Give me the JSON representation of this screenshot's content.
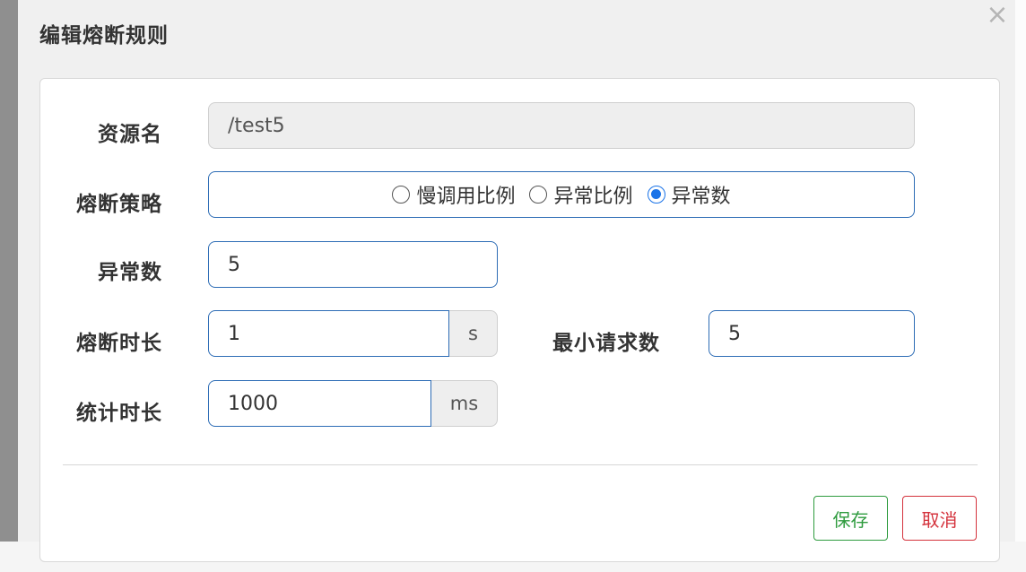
{
  "modal": {
    "title": "编辑熔断规则",
    "close_glyph": "×"
  },
  "form": {
    "resource": {
      "label": "资源名",
      "value": "/test5"
    },
    "strategy": {
      "label": "熔断策略",
      "options": [
        "慢调用比例",
        "异常比例",
        "异常数"
      ],
      "selected": "异常数"
    },
    "exception_count": {
      "label": "异常数",
      "value": "5"
    },
    "break_duration": {
      "label": "熔断时长",
      "value": "1",
      "unit": "s"
    },
    "min_request": {
      "label": "最小请求数",
      "value": "5"
    },
    "stat_duration": {
      "label": "统计时长",
      "value": "1000",
      "unit": "ms"
    }
  },
  "footer": {
    "save_label": "保存",
    "cancel_label": "取消"
  },
  "colors": {
    "primary_border": "#2d6cb5",
    "save": "#2e9b3e",
    "cancel": "#d4323c",
    "radio_checked": "#1a73e8"
  }
}
